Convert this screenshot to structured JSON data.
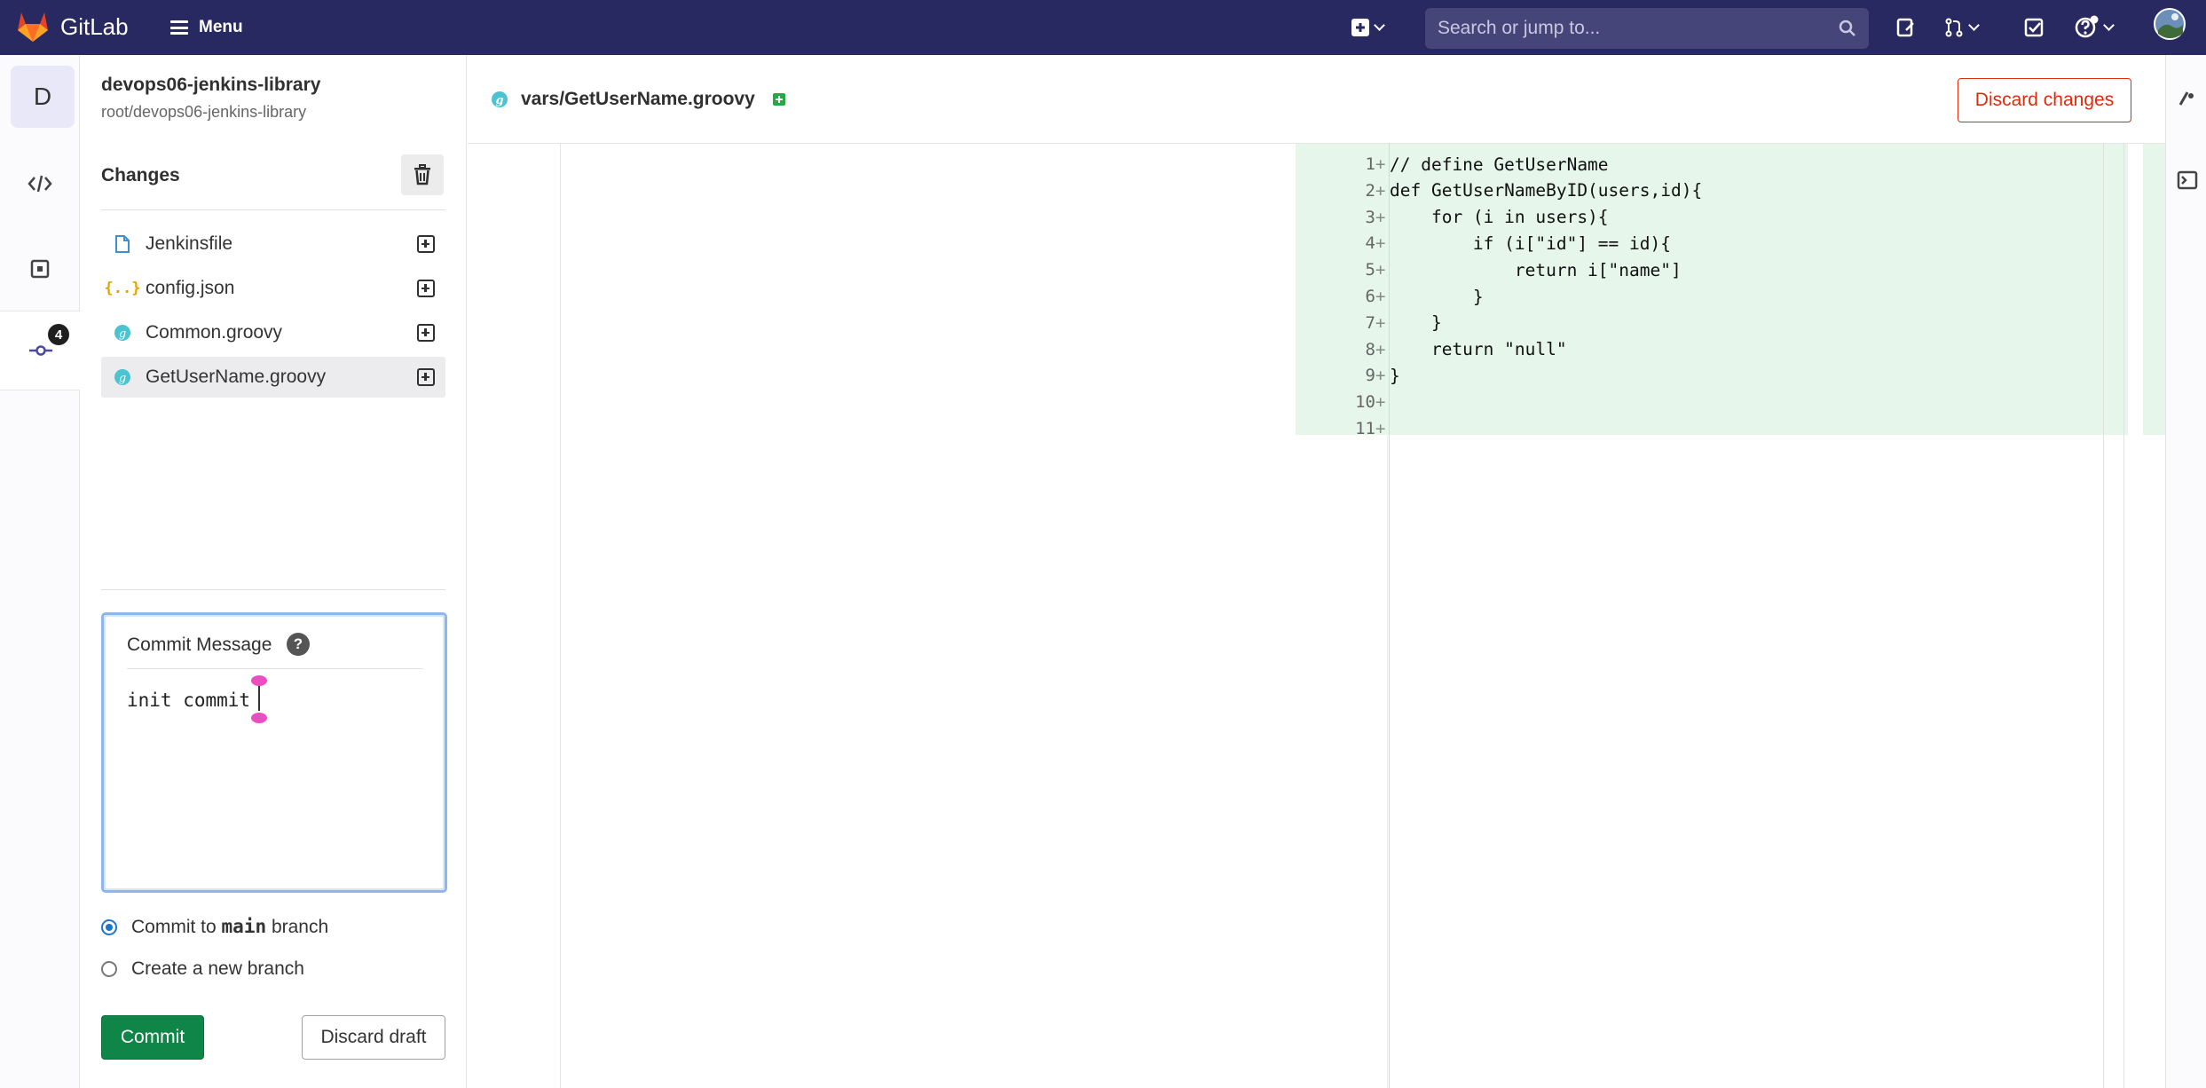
{
  "topbar": {
    "brand": "GitLab",
    "menu_label": "Menu",
    "search_placeholder": "Search or jump to..."
  },
  "minibar": {
    "project_initial": "D",
    "commit_count": "4"
  },
  "sidebar": {
    "project_name": "devops06-jenkins-library",
    "project_path": "root/devops06-jenkins-library",
    "changes_title": "Changes",
    "files": [
      {
        "name": "Jenkinsfile",
        "icon": "file-icon"
      },
      {
        "name": "config.json",
        "icon": "json-icon"
      },
      {
        "name": "Common.groovy",
        "icon": "groovy-icon"
      },
      {
        "name": "GetUserName.groovy",
        "icon": "groovy-icon"
      }
    ],
    "commit_message_label": "Commit Message",
    "commit_message_value": "init commit",
    "commit_to_prefix": "Commit to",
    "branch_name": "main",
    "commit_to_suffix": "branch",
    "new_branch_label": "Create a new branch",
    "commit_button": "Commit",
    "discard_draft_button": "Discard draft"
  },
  "editor": {
    "file_path": "vars/GetUserName.groovy",
    "discard_changes_button": "Discard changes",
    "lines": [
      {
        "num": "1",
        "code": "// define GetUserName"
      },
      {
        "num": "2",
        "code": "def GetUserNameByID(users,id){"
      },
      {
        "num": "3",
        "code": "    for (i in users){"
      },
      {
        "num": "4",
        "code": "        if (i[\"id\"] == id){"
      },
      {
        "num": "5",
        "code": "            return i[\"name\"]"
      },
      {
        "num": "6",
        "code": "        }"
      },
      {
        "num": "7",
        "code": "    }"
      },
      {
        "num": "8",
        "code": "    return \"null\""
      },
      {
        "num": "9",
        "code": "}"
      },
      {
        "num": "10",
        "code": ""
      },
      {
        "num": "11",
        "code": ""
      }
    ]
  },
  "colors": {
    "topbar": "#292961",
    "commit_green": "#108548",
    "danger_red": "#dd2b0e",
    "added_line_bg": "#e6f6ea"
  }
}
